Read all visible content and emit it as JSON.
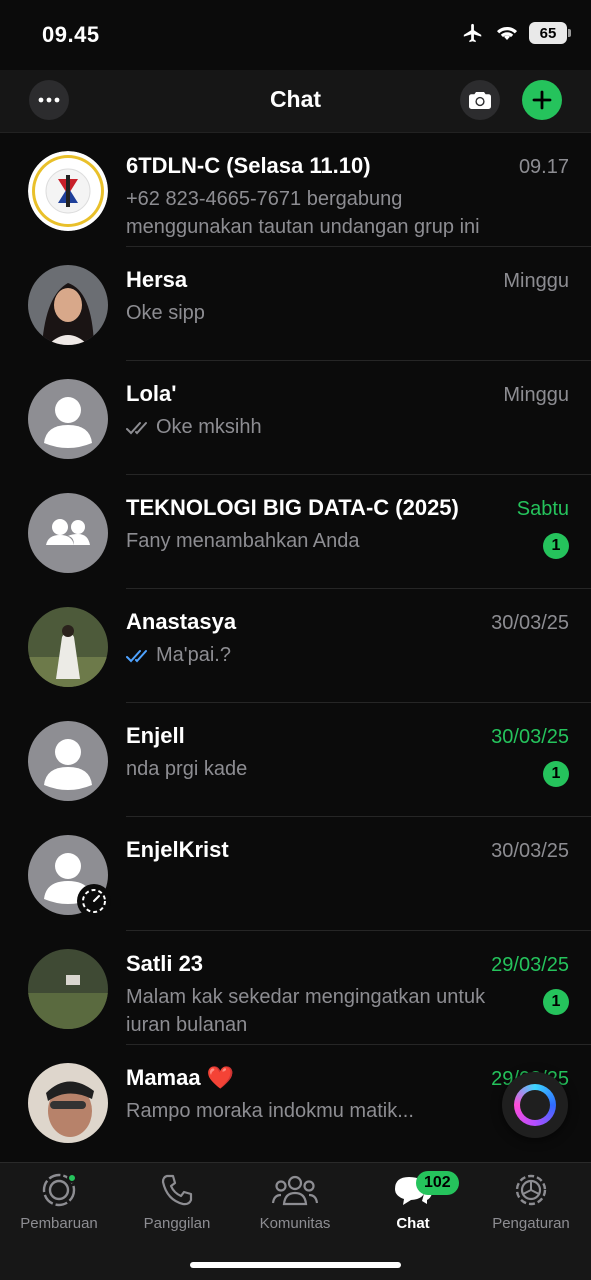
{
  "status_bar": {
    "time": "09.45",
    "battery": "65"
  },
  "header": {
    "title": "Chat"
  },
  "chats": [
    {
      "name": "6TDLN-C (Selasa 11.10)",
      "time": "09.17",
      "preview": "+62 823-4665-7671 bergabung menggunakan tautan undangan grup ini"
    },
    {
      "name": "Hersa",
      "time": "Minggu",
      "preview": "Oke sipp"
    },
    {
      "name": "Lola'",
      "time": "Minggu",
      "preview": "Oke mksihh"
    },
    {
      "name": "TEKNOLOGI BIG DATA-C (2025)",
      "time": "Sabtu",
      "preview": "Fany menambahkan Anda",
      "unread": "1"
    },
    {
      "name": "Anastasya",
      "time": "30/03/25",
      "preview": "Ma'pai.?"
    },
    {
      "name": "Enjell",
      "time": "30/03/25",
      "preview": "nda prgi kade",
      "unread": "1"
    },
    {
      "name": "EnjelKrist",
      "time": "30/03/25",
      "preview": ""
    },
    {
      "name": "Satli 23",
      "time": "29/03/25",
      "preview": "Malam kak  sekedar mengingatkan untuk iuran bulanan",
      "unread": "1"
    },
    {
      "name": "Mamaa ❤️",
      "time": "29/03/25",
      "preview": "Rampo moraka indokmu matik..."
    }
  ],
  "tabs": [
    {
      "label": "Pembaruan"
    },
    {
      "label": "Panggilan"
    },
    {
      "label": "Komunitas"
    },
    {
      "label": "Chat",
      "badge": "102"
    },
    {
      "label": "Pengaturan"
    }
  ],
  "colors": {
    "accent": "#25c35c",
    "background": "#0b0b0b",
    "header": "#161616",
    "secondary_text": "#8d8d92",
    "read_ticks": "#4fa3ff"
  },
  "icons": [
    "airplane-icon",
    "wifi-icon",
    "battery-icon",
    "more-icon",
    "camera-icon",
    "plus-icon",
    "double-check-icon",
    "group-icon",
    "person-icon",
    "status-ring-icon",
    "ai-assistant-icon",
    "updates-icon",
    "phone-icon",
    "community-icon",
    "chat-bubble-icon",
    "settings-icon"
  ]
}
